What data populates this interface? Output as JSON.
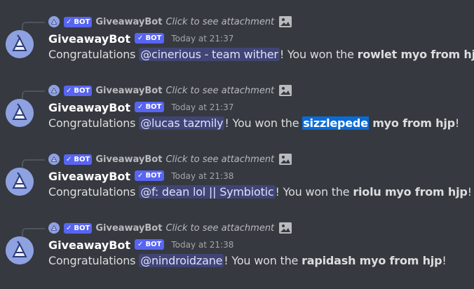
{
  "colors": {
    "background": "#36393f",
    "bot_badge": "#5865f2",
    "mention_bg": "#414675",
    "selection": "#0b6bd6"
  },
  "messages": [
    {
      "reply": {
        "badge_check": "✓",
        "badge": "BOT",
        "author": "GiveawayBot",
        "attachment_text": "Click to see attachment",
        "attachment_icon": "image-icon"
      },
      "author": "GiveawayBot",
      "badge_check": "✓",
      "badge": "BOT",
      "timestamp": "Today at 21:37",
      "text_prefix": "Congratulations ",
      "mention": "@cinerious - team wither",
      "text_middle": "! You won the ",
      "prize_highlight": "",
      "prize": "rowlet myo from hjp",
      "text_suffix": "!"
    },
    {
      "reply": {
        "badge_check": "✓",
        "badge": "BOT",
        "author": "GiveawayBot",
        "attachment_text": "Click to see attachment",
        "attachment_icon": "image-icon"
      },
      "author": "GiveawayBot",
      "badge_check": "✓",
      "badge": "BOT",
      "timestamp": "Today at 21:37",
      "text_prefix": "Congratulations ",
      "mention": "@lucas tazmily",
      "text_middle": "! You won the ",
      "prize_highlight": "sizzlepede",
      "prize": " myo from hjp",
      "text_suffix": "!"
    },
    {
      "reply": {
        "badge_check": "✓",
        "badge": "BOT",
        "author": "GiveawayBot",
        "attachment_text": "Click to see attachment",
        "attachment_icon": "image-icon"
      },
      "author": "GiveawayBot",
      "badge_check": "✓",
      "badge": "BOT",
      "timestamp": "Today at 21:38",
      "text_prefix": "Congratulations ",
      "mention": "@f: dean lol || Symbiotic",
      "text_middle": "! You won the ",
      "prize_highlight": "",
      "prize": "riolu myo from hjp",
      "text_suffix": "!"
    },
    {
      "reply": {
        "badge_check": "✓",
        "badge": "BOT",
        "author": "GiveawayBot",
        "attachment_text": "Click to see attachment",
        "attachment_icon": "image-icon"
      },
      "author": "GiveawayBot",
      "badge_check": "✓",
      "badge": "BOT",
      "timestamp": "Today at 21:38",
      "text_prefix": "Congratulations ",
      "mention": "@nindroidzane",
      "text_middle": "! You won the ",
      "prize_highlight": "",
      "prize": "rapidash myo from hjp",
      "text_suffix": "!"
    }
  ]
}
